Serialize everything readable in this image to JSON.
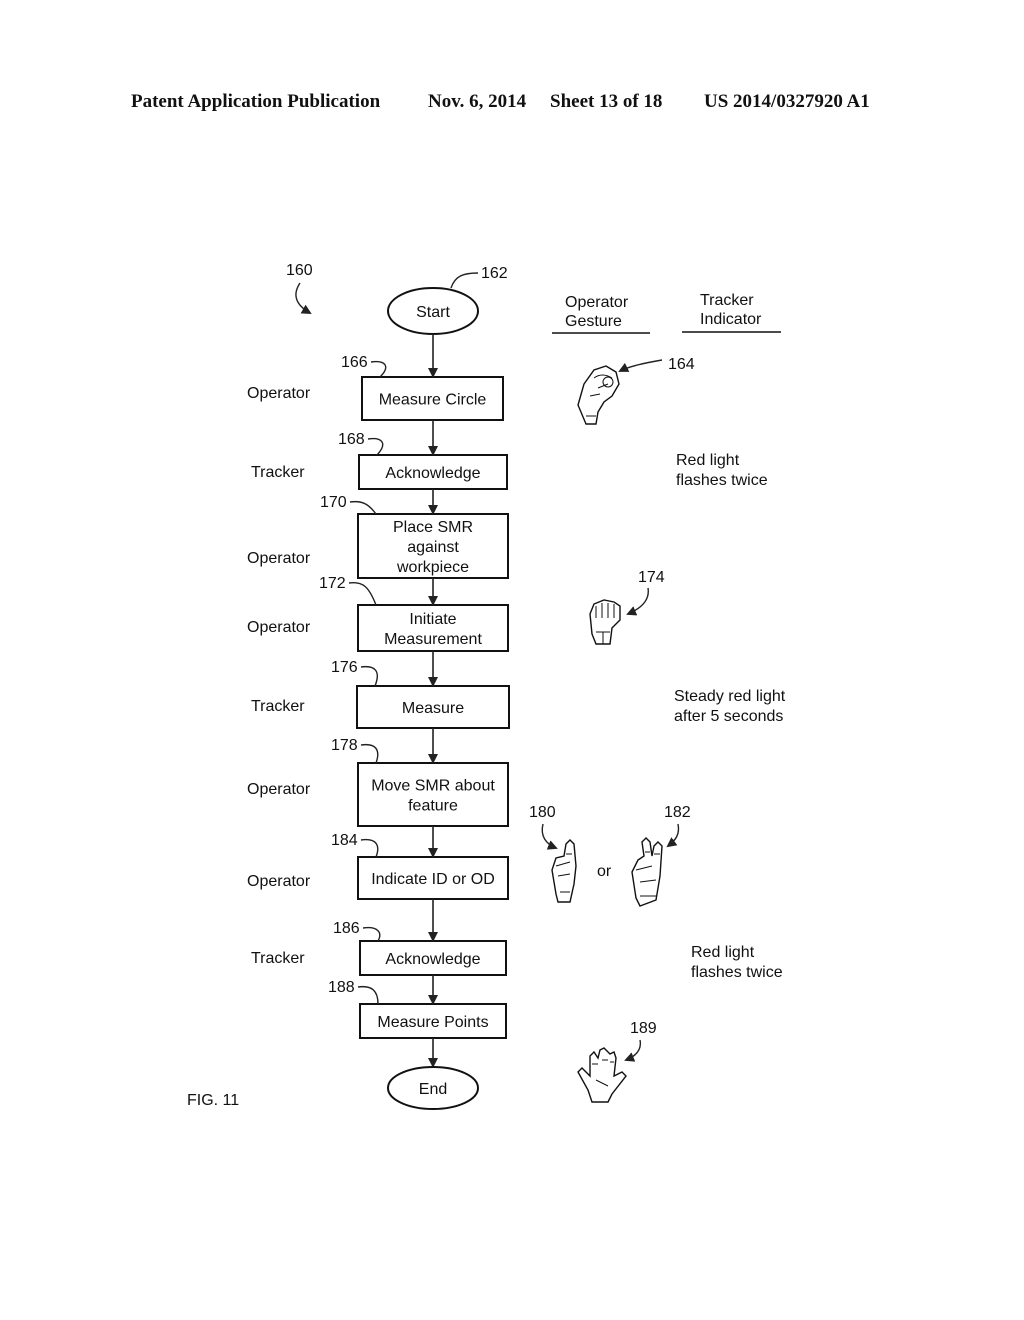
{
  "header": {
    "publication": "Patent Application Publication",
    "date": "Nov. 6, 2014",
    "sheet": "Sheet 13 of 18",
    "patent_number": "US 2014/0327920 A1"
  },
  "figure": {
    "label": "FIG. 11",
    "ref": "160",
    "columns": {
      "operator_gesture": [
        "Operator",
        "Gesture"
      ],
      "tracker_indicator": [
        "Tracker",
        "Indicator"
      ]
    },
    "start": {
      "label": "Start",
      "ref": "162"
    },
    "end": {
      "label": "End"
    },
    "steps": [
      {
        "ref": "166",
        "actor": "Operator",
        "lines": [
          "Measure Circle"
        ]
      },
      {
        "ref": "168",
        "actor": "Tracker",
        "lines": [
          "Acknowledge"
        ]
      },
      {
        "ref": "170",
        "actor": "Operator",
        "lines": [
          "Place SMR",
          "against",
          "workpiece"
        ]
      },
      {
        "ref": "172",
        "actor": "Operator",
        "lines": [
          "Initiate",
          "Measurement"
        ]
      },
      {
        "ref": "176",
        "actor": "Tracker",
        "lines": [
          "Measure"
        ]
      },
      {
        "ref": "178",
        "actor": "Operator",
        "lines": [
          "Move SMR about",
          "feature"
        ]
      },
      {
        "ref": "184",
        "actor": "Operator",
        "lines": [
          "Indicate ID or OD"
        ]
      },
      {
        "ref": "186",
        "actor": "Tracker",
        "lines": [
          "Acknowledge"
        ]
      },
      {
        "ref": "188",
        "actor": "",
        "lines": [
          "Measure Points"
        ]
      }
    ],
    "indicators": [
      {
        "lines": [
          "Red light",
          "flashes twice"
        ]
      },
      {
        "lines": [
          "Steady red light",
          "after 5 seconds"
        ]
      },
      {
        "lines": [
          "Red light",
          "flashes twice"
        ]
      }
    ],
    "gestures": [
      {
        "ref": "164",
        "icon": "ok-circle-hand-icon"
      },
      {
        "ref": "174",
        "icon": "fist-hand-icon"
      },
      {
        "ref": "180",
        "icon": "one-finger-hand-icon"
      },
      {
        "ref": "182",
        "icon": "two-finger-hand-icon"
      },
      {
        "ref": "189",
        "icon": "open-palm-hand-icon"
      }
    ],
    "or_label": "or"
  }
}
